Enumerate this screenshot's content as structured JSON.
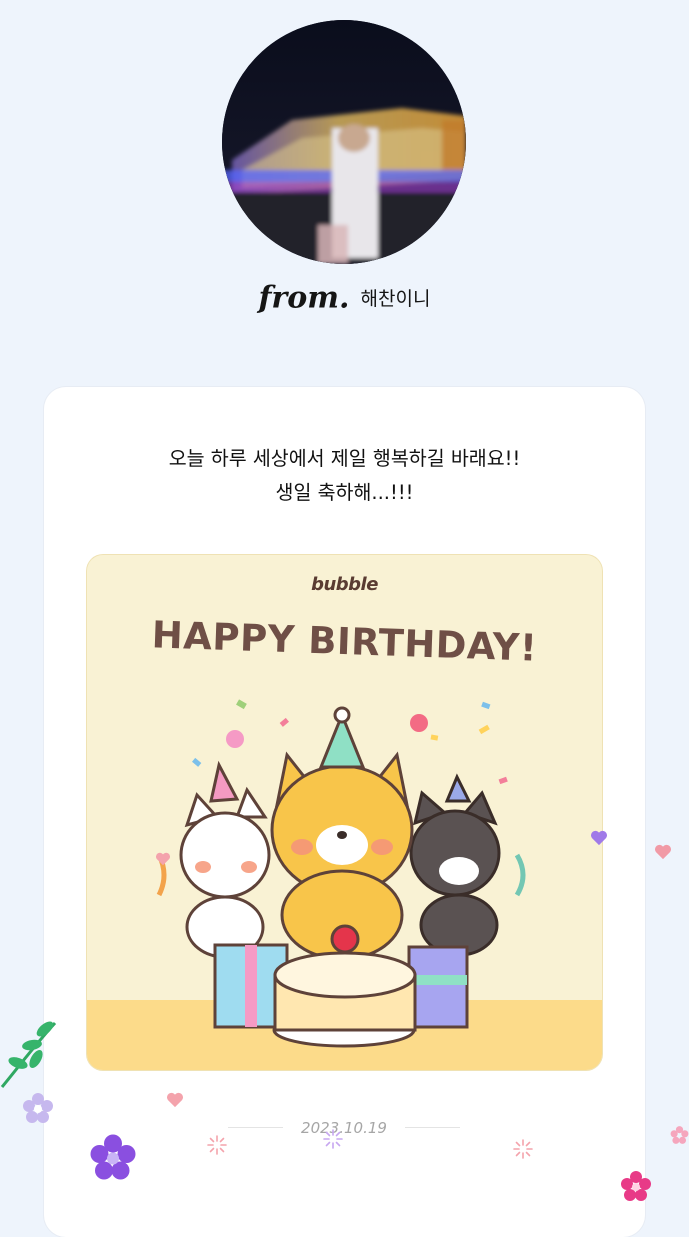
{
  "sender": {
    "from_label": "from.",
    "name": "해찬이니"
  },
  "message": {
    "line1": "오늘 하루 세상에서 제일 행복하길 바래요!!",
    "line2": "생일 축하해...!!!"
  },
  "birthday_card": {
    "brand": "bubble",
    "headline": "HAPPY BIRTHDAY!"
  },
  "date": "2023.10.19",
  "colors": {
    "page_background": "#eef4fc",
    "card_background": "#ffffff",
    "birthday_card_background": "#f9f2d4",
    "headline": "#6f4f46"
  }
}
